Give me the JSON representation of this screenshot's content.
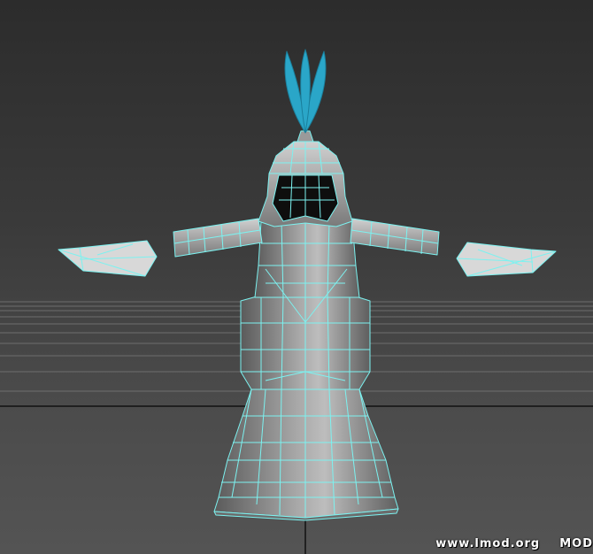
{
  "viewport": {
    "background_top": "#2c2c2c",
    "background_bottom": "#545454",
    "grid_color": "#6e6e6e",
    "axis_color": "#111111",
    "mesh_fill": "#8a8a8a",
    "wire_color": "#7cf2f0",
    "plume_color": "#2aa6c8"
  },
  "model": {
    "name": "armored-figure-mesh",
    "parts": [
      "plume",
      "helmet",
      "face-opening",
      "left-shoulder-arm",
      "right-shoulder-arm",
      "left-hand",
      "right-hand",
      "chest-armor",
      "waist",
      "skirt"
    ]
  },
  "watermark": {
    "site": "www.lmod.org",
    "tag": "MOD"
  }
}
